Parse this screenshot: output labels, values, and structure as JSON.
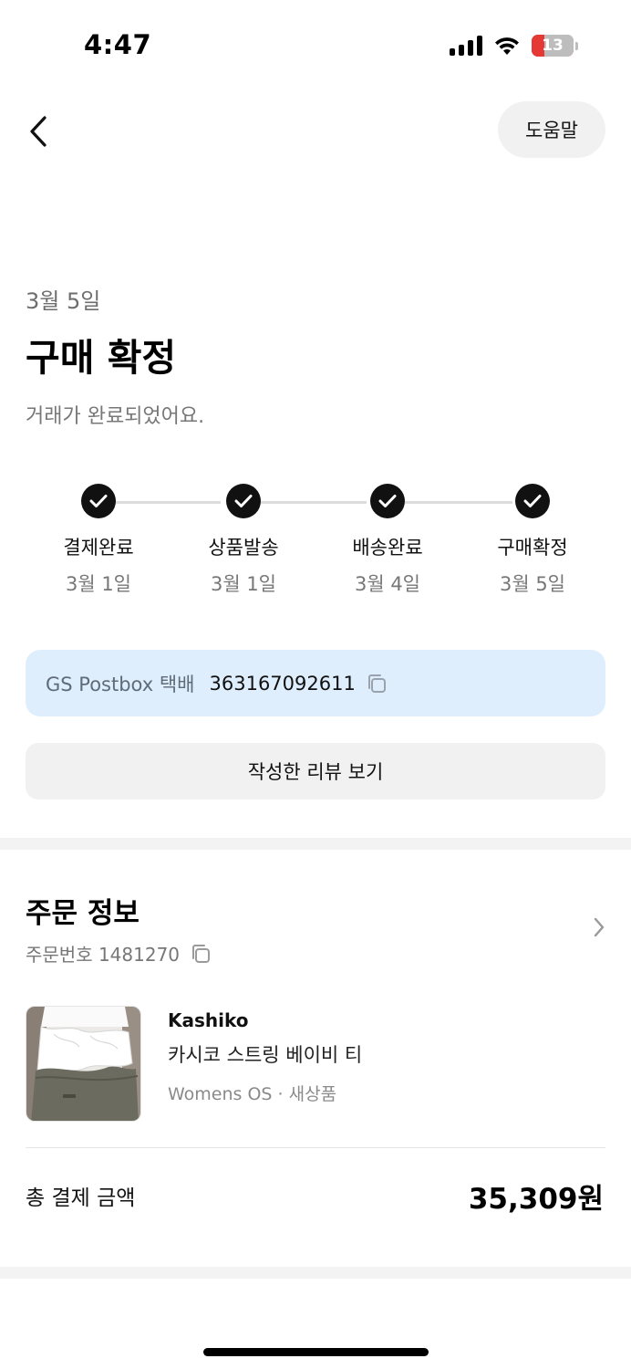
{
  "status_bar": {
    "time": "4:47",
    "battery": "13",
    "battery_level": 0.13,
    "icons": [
      "signal-icon",
      "wifi-icon",
      "battery-icon"
    ]
  },
  "header": {
    "back_icon": "chevron-left-icon",
    "help_label": "도움말"
  },
  "summary": {
    "date": "3월 5일",
    "title": "구매 확정",
    "subtitle": "거래가 완료되었어요."
  },
  "progress": {
    "steps": [
      {
        "label": "결제완료",
        "date": "3월 1일",
        "done": true
      },
      {
        "label": "상품발송",
        "date": "3월 1일",
        "done": true
      },
      {
        "label": "배송완료",
        "date": "3월 4일",
        "done": true
      },
      {
        "label": "구매확정",
        "date": "3월 5일",
        "done": true
      }
    ]
  },
  "tracking": {
    "carrier": "GS Postbox 택배",
    "number": "363167092611",
    "copy_icon": "copy-icon"
  },
  "review_button_label": "작성한 리뷰 보기",
  "order": {
    "header": "주문 정보",
    "number_label": "주문번호 1481270",
    "chevron_icon": "chevron-right-icon",
    "product": {
      "brand": "Kashiko",
      "name": "카시코 스트링 베이비 티",
      "meta": "Womens OS · 새상품",
      "image_logo": "Kashiko"
    },
    "total_label": "총 결제 금액",
    "total_value": "35,309원"
  },
  "colors": {
    "tracking_bg": "#dfeefd",
    "button_bg": "#f1f1f1",
    "check_bg": "#111111",
    "battery_red": "#e53935"
  }
}
